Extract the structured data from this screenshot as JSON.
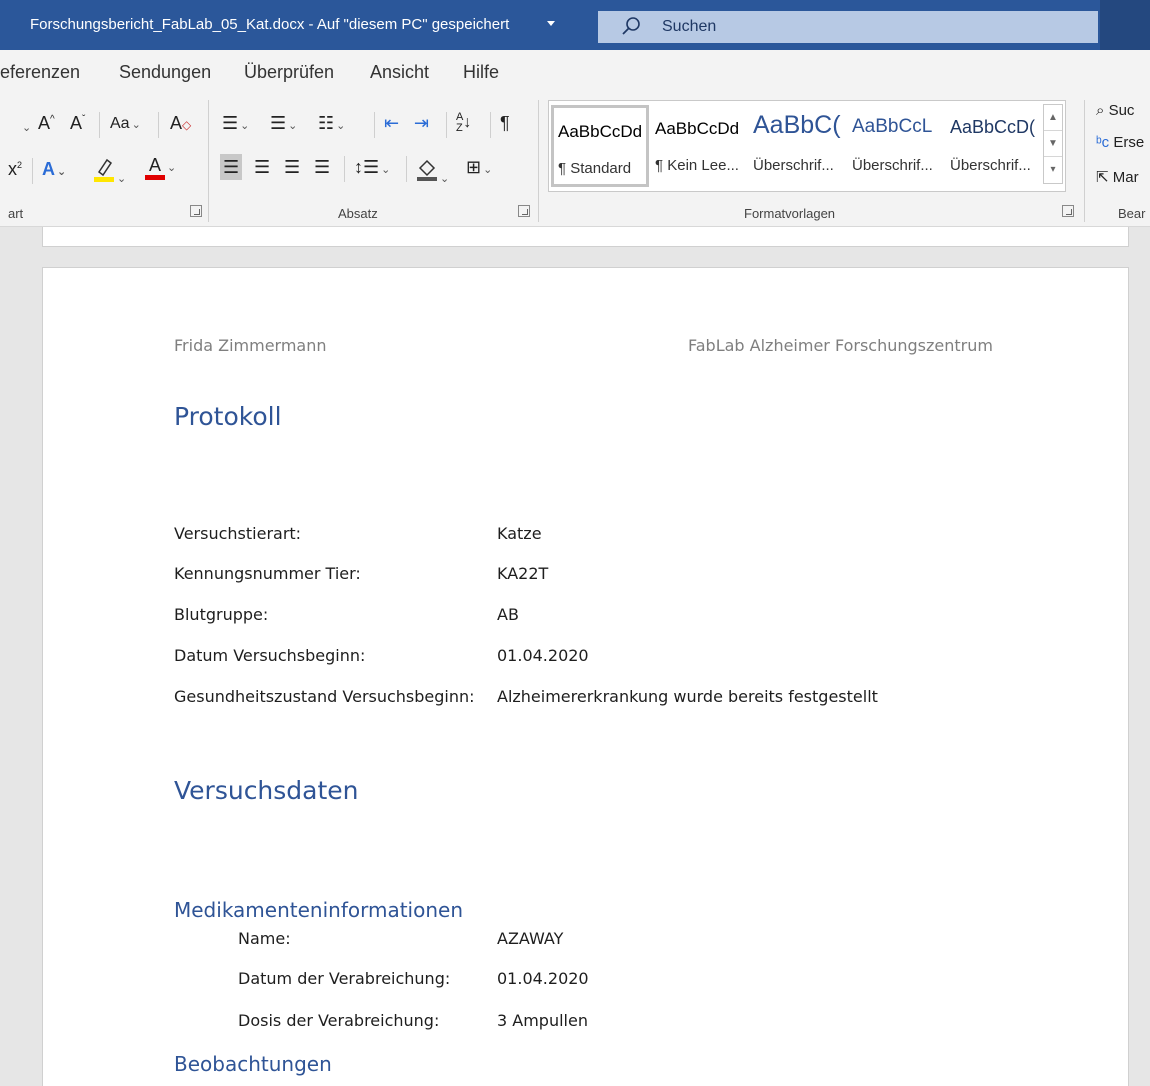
{
  "titlebar": {
    "document_title": "Forschungsbericht_FabLab_05_Kat.docx  -  Auf \"diesem PC\" gespeichert",
    "search_label": "Suchen"
  },
  "tabs": [
    "eferenzen",
    "Sendungen",
    "Überprüfen",
    "Ansicht",
    "Hilfe"
  ],
  "ribbon": {
    "font_group_label": "art",
    "paragraph_group_label": "Absatz",
    "styles_group_label": "Formatvorlagen",
    "editing_group_label": "Bear",
    "styles": [
      {
        "sample": "AaBbCcDd",
        "name": "¶ Standard"
      },
      {
        "sample": "AaBbCcDd",
        "name": "¶ Kein Lee..."
      },
      {
        "sample": "AaBbC(",
        "name": "Überschrif..."
      },
      {
        "sample": "AaBbCcL",
        "name": "Überschrif..."
      },
      {
        "sample": "AaBbCcD(",
        "name": "Überschrif..."
      }
    ],
    "editing": {
      "find": "Suc",
      "replace": "Erse",
      "select": "Mar"
    }
  },
  "document": {
    "header_left": "Frida Zimmermann",
    "header_right": "FabLab Alzheimer Forschungszentrum",
    "title": "Protokoll",
    "fields": [
      {
        "label": "Versuchstierart:",
        "value": "Katze"
      },
      {
        "label": "Kennungsnummer Tier:",
        "value": "KA22T"
      },
      {
        "label": "Blutgruppe:",
        "value": "AB"
      },
      {
        "label": "Datum Versuchsbeginn:",
        "value": "01.04.2020"
      },
      {
        "label": "Gesundheitszustand Versuchsbeginn:",
        "value": "Alzheimererkrankung wurde bereits festgestellt"
      }
    ],
    "section_title": "Versuchsdaten",
    "medication": {
      "heading": "Medikamenteninformationen",
      "fields": [
        {
          "label": "Name:",
          "value": "AZAWAY"
        },
        {
          "label": "Datum der Verabreichung:",
          "value": "01.04.2020"
        },
        {
          "label": "Dosis der Verabreichung:",
          "value": "3 Ampullen"
        }
      ]
    },
    "observations_heading": "Beobachtungen"
  },
  "colors": {
    "titlebar": "#2b579a",
    "heading": "#2f5496",
    "ribbon": "#f3f3f3"
  }
}
